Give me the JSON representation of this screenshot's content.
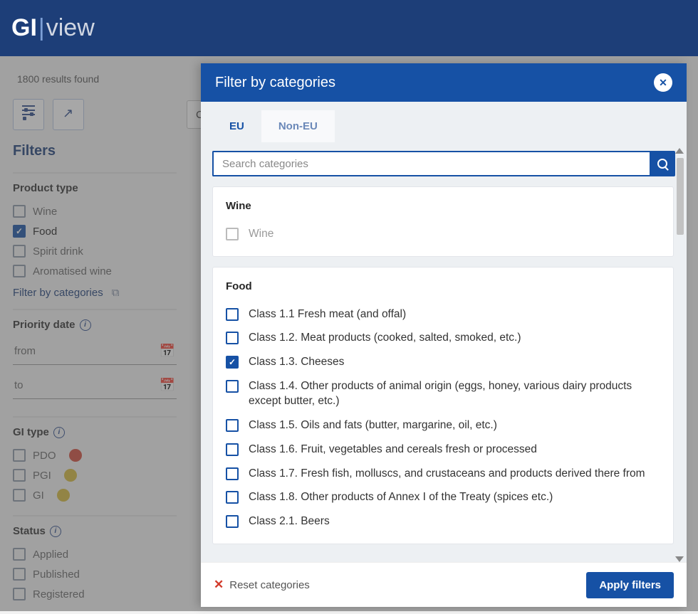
{
  "app": {
    "logo_g": "GI",
    "logo_view": "view"
  },
  "page": {
    "results_text": "1800 results found",
    "country_btn": "Country",
    "filters_title": "Filters",
    "product_type": {
      "title": "Product type",
      "items": [
        {
          "label": "Wine",
          "checked": false
        },
        {
          "label": "Food",
          "checked": true
        },
        {
          "label": "Spirit drink",
          "checked": false
        },
        {
          "label": "Aromatised wine",
          "checked": false
        }
      ],
      "link": "Filter by categories"
    },
    "priority_date": {
      "title": "Priority date",
      "from": "from",
      "to": "to"
    },
    "gi_type": {
      "title": "GI type",
      "items": [
        {
          "label": "PDO",
          "color": "red"
        },
        {
          "label": "PGI",
          "color": "yel"
        },
        {
          "label": "GI",
          "color": "yel"
        }
      ]
    },
    "status": {
      "title": "Status",
      "items": [
        {
          "label": "Applied"
        },
        {
          "label": "Published"
        },
        {
          "label": "Registered"
        }
      ]
    }
  },
  "modal": {
    "title": "Filter by categories",
    "tabs": {
      "eu": "EU",
      "noneu": "Non-EU"
    },
    "search_placeholder": "Search categories",
    "groups": [
      {
        "title": "Wine",
        "items": [
          {
            "label": "Wine",
            "checked": false,
            "disabled": true
          }
        ]
      },
      {
        "title": "Food",
        "items": [
          {
            "label": "Class 1.1 Fresh meat (and offal)",
            "checked": false
          },
          {
            "label": "Class 1.2. Meat products (cooked, salted, smoked, etc.)",
            "checked": false
          },
          {
            "label": "Class 1.3. Cheeses",
            "checked": true
          },
          {
            "label": "Class 1.4. Other products of animal origin (eggs, honey, various dairy products except butter, etc.)",
            "checked": false
          },
          {
            "label": "Class 1.5. Oils and fats (butter, margarine, oil, etc.)",
            "checked": false
          },
          {
            "label": "Class 1.6. Fruit, vegetables and cereals fresh or processed",
            "checked": false
          },
          {
            "label": "Class 1.7. Fresh fish, molluscs, and crustaceans and products derived there from",
            "checked": false
          },
          {
            "label": "Class 1.8. Other products of Annex I of the Treaty (spices etc.)",
            "checked": false
          },
          {
            "label": "Class 2.1. Beers",
            "checked": false
          }
        ]
      }
    ],
    "reset": "Reset categories",
    "apply": "Apply filters"
  }
}
